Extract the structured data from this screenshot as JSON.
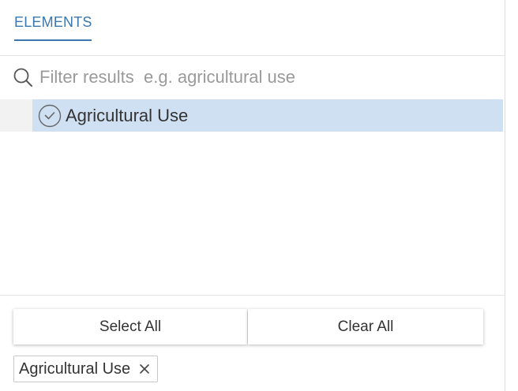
{
  "tabs": [
    {
      "label": "ELEMENTS",
      "active": true
    }
  ],
  "colors": {
    "accent": "#3b78ad",
    "selected_row": "#cfe0f3"
  },
  "search": {
    "icon": "search-icon",
    "value": "",
    "placeholder": "Filter results  e.g. agricultural use"
  },
  "list": {
    "items": [
      {
        "label": "Agricultural Use",
        "selected": true,
        "icon": "check-circle-icon"
      }
    ]
  },
  "actions": {
    "select_all": "Select All",
    "clear_all": "Clear All"
  },
  "selected_chips": [
    {
      "label": "Agricultural Use",
      "remove_icon": "close-icon"
    }
  ]
}
